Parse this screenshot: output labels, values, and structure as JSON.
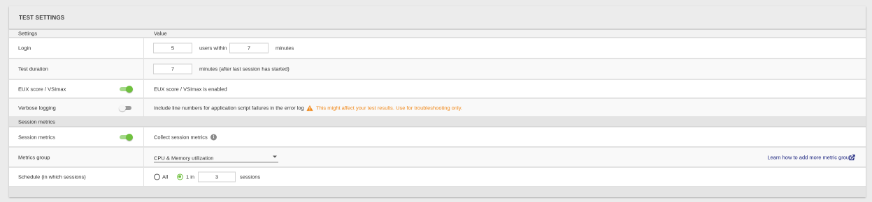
{
  "panel": {
    "title": "TEST SETTINGS",
    "col_settings": "Settings",
    "col_value": "Value"
  },
  "login": {
    "label": "Login",
    "users": "5",
    "users_within": "users within",
    "minutes": "7",
    "minutes_label": "minutes"
  },
  "duration": {
    "label": "Test duration",
    "value": "7",
    "suffix": "minutes (after last session has started)"
  },
  "eux": {
    "label": "EUX score / VSImax",
    "enabled": true,
    "status": "EUX score / VSImax is enabled"
  },
  "verbose": {
    "label": "Verbose logging",
    "enabled": false,
    "description": "Include line numbers for application script failures in the error log",
    "warning": "This might affect your test results. Use for troubleshooting only."
  },
  "session_section": {
    "title": "Session metrics"
  },
  "session_metrics": {
    "label": "Session metrics",
    "enabled": true,
    "description": "Collect session metrics",
    "info_icon": "info-icon"
  },
  "metrics_group": {
    "label": "Metrics group",
    "selected": "CPU & Memory utilization",
    "link": "Learn how to add more metric groups",
    "link_icon": "external-link-icon"
  },
  "schedule": {
    "label": "Schedule (in which sessions)",
    "option_all": "All",
    "option_one_in": "1 in",
    "selected": "1 in",
    "value": "3",
    "suffix": "sessions"
  },
  "colors": {
    "toggle_on": "#6fc13e",
    "warning": "#f0891b",
    "link": "#1a237e"
  }
}
